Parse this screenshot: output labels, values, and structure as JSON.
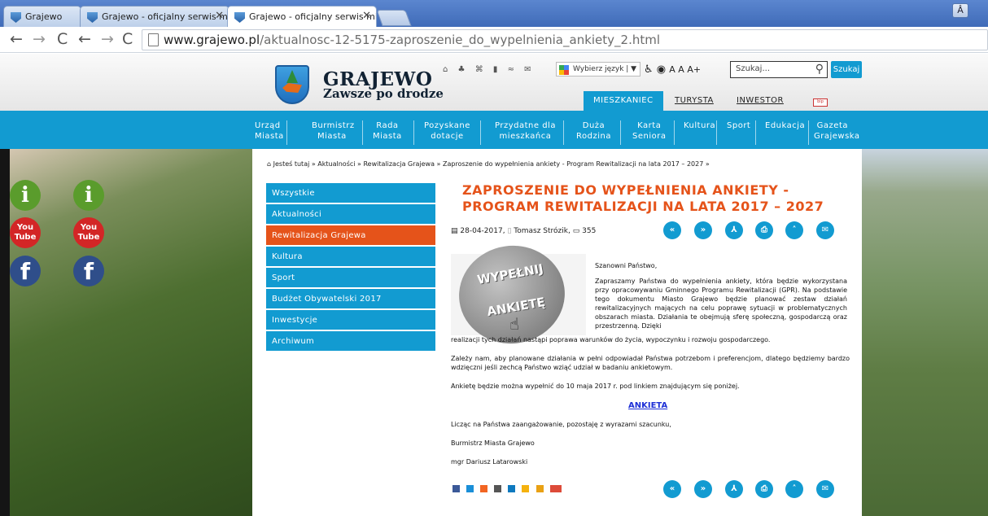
{
  "browser": {
    "tabs": [
      {
        "label": "Grajewo"
      },
      {
        "label": "Grajewo - oficjalny serwis mi"
      },
      {
        "label": "Grajewo - oficjalny serwis mi"
      }
    ],
    "url_host": "www.grajewo.pl",
    "url_path": "/aktualnosc-12-5175-zaproszenie_do_wypelnienia_ankiety_2.html",
    "window_button": "Â"
  },
  "header": {
    "brand": "GRAJEWO",
    "motto": "Zawsze po drodze",
    "language_select": "Wybierz język",
    "access_text": "A A A+",
    "search_placeholder": "Szukaj...",
    "search_button": "Szukaj",
    "audience_tabs": [
      "MIESZKANIEC",
      "TURYSTA",
      "INWESTOR"
    ],
    "bip_label": "bip"
  },
  "main_nav": [
    {
      "l1": "Urząd",
      "l2": "Miasta"
    },
    {
      "l1": "Burmistrz",
      "l2": "Miasta"
    },
    {
      "l1": "Rada",
      "l2": "Miasta"
    },
    {
      "l1": "Pozyskane",
      "l2": "dotacje"
    },
    {
      "l1": "Przydatne dla",
      "l2": "mieszkańca"
    },
    {
      "l1": "Duża",
      "l2": "Rodzina"
    },
    {
      "l1": "Karta",
      "l2": "Seniora"
    },
    {
      "l1": "Kultura",
      "l2": ""
    },
    {
      "l1": "Sport",
      "l2": ""
    },
    {
      "l1": "Edukacja",
      "l2": ""
    },
    {
      "l1": "Gazeta",
      "l2": "Grajewska"
    }
  ],
  "breadcrumb": {
    "prefix": "Jesteś tutaj",
    "items": [
      "Aktualności",
      "Rewitalizacja Grajewa",
      "Zaproszenie do wypełnienia ankiety - Program Rewitalizacji na lata 2017 – 2027"
    ]
  },
  "sidebar": {
    "items": [
      {
        "label": "Wszystkie"
      },
      {
        "label": "Aktualności"
      },
      {
        "label": "Rewitalizacja Grajewa"
      },
      {
        "label": "Kultura"
      },
      {
        "label": "Sport"
      },
      {
        "label": "Budżet Obywatelski 2017"
      },
      {
        "label": "Inwestycje"
      },
      {
        "label": "Archiwum"
      }
    ]
  },
  "article": {
    "title": "ZAPROSZENIE DO WYPEŁNIENIA ANKIETY - PROGRAM REWITALIZACJI NA LATA 2017 – 2027",
    "date": "28-04-2017,",
    "author": "Tomasz Strózik,",
    "views": "355",
    "image_text": [
      "WYPEŁNIJ",
      "ANKIETĘ"
    ],
    "greeting": "Szanowni Państwo,",
    "p1a": "Zapraszamy Państwa do wypełnienia ankiety, która będzie wykorzystana przy opracowywaniu Gminnego Programu Rewitalizacji (GPR). Na podstawie tego dokumentu Miasto Grajewo będzie planować zestaw działań rewitalizacyjnych mających na celu poprawę sytuacji w problematycznych obszarach miasta. Działania te obejmują sferę społeczną, gospodarczą oraz przestrzenną. Dzięki",
    "p1b": "realizacji tych działań nastąpi poprawa warunków do życia, wypoczynku i rozwoju gospodarczego.",
    "p2": "Zależy nam, aby planowane działania w pełni odpowiadał Państwa potrzebom i preferencjom, dlatego będziemy bardzo wdzięczni jeśli zechcą Państwo wziąć udział w badaniu ankietowym.",
    "p3": "Ankietę będzie można wypełnić do 10 maja 2017 r. pod linkiem znajdującym się poniżej.",
    "link": "ANKIETA",
    "p4": "Licząc na Państwa zaangażowanie, pozostaję z wyrazami szacunku,",
    "sign1": "Burmistrz Miasta Grajewo",
    "sign2": "mgr Dariusz Latarowski"
  },
  "colors": {
    "accent": "#129bd1",
    "active": "#e5531a"
  }
}
